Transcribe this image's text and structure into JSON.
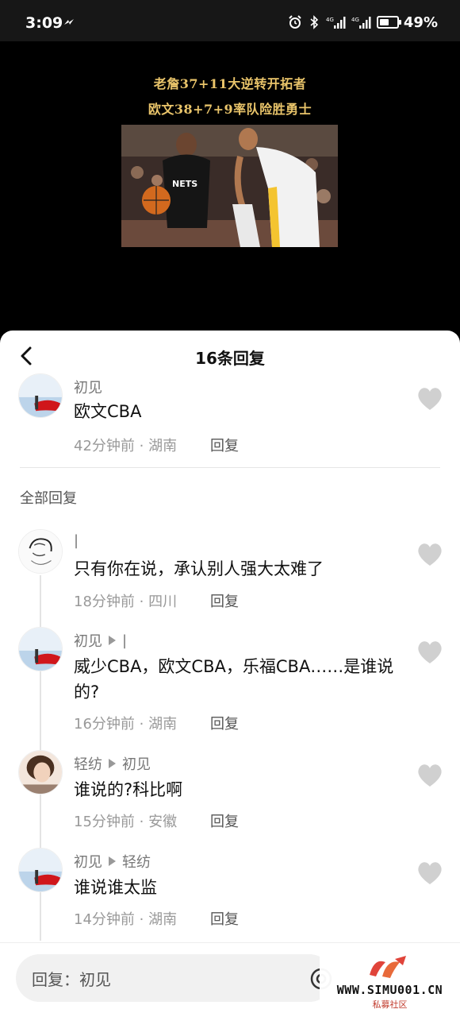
{
  "status_bar": {
    "time": "3:09",
    "battery_pct": "49%",
    "icons": [
      "do-not-disturb-icon",
      "alarm-icon",
      "bluetooth-icon",
      "signal-4g-icon",
      "signal-4g-icon",
      "battery-icon"
    ]
  },
  "video": {
    "headline_line1": "老詹37+11大逆转开拓者",
    "headline_line2": "欧文38+7+9率队险胜勇士",
    "photo_jersey_text": "NETS"
  },
  "sheet": {
    "title": "16条回复",
    "original": {
      "author": "初见",
      "text": "欧文CBA",
      "meta": "42分钟前 · 湖南",
      "reply_label": "回复"
    },
    "section_label": "全部回复",
    "replies": [
      {
        "author": "|",
        "reply_to": "",
        "text": "只有你在说，承认别人强大太难了",
        "meta": "18分钟前 · 四川",
        "reply_label": "回复"
      },
      {
        "author": "初见",
        "reply_to": "|",
        "text": "威少CBA，欧文CBA，乐福CBA……是谁说的?",
        "meta": "16分钟前 · 湖南",
        "reply_label": "回复"
      },
      {
        "author": "轻纺",
        "reply_to": "初见",
        "text": "谁说的?科比啊",
        "meta": "15分钟前 · 安徽",
        "reply_label": "回复"
      },
      {
        "author": "初见",
        "reply_to": "轻纺",
        "text": "谁说谁太监",
        "meta": "14分钟前 · 湖南",
        "reply_label": "回复"
      }
    ],
    "input_placeholder": "回复：初见"
  },
  "watermark": {
    "site": "WWW.SIMU001.CN",
    "sub": "私募社区"
  },
  "colors": {
    "headline": "#e9c46a",
    "sheet_bg": "#ffffff",
    "heart": "#d0d0d0"
  }
}
